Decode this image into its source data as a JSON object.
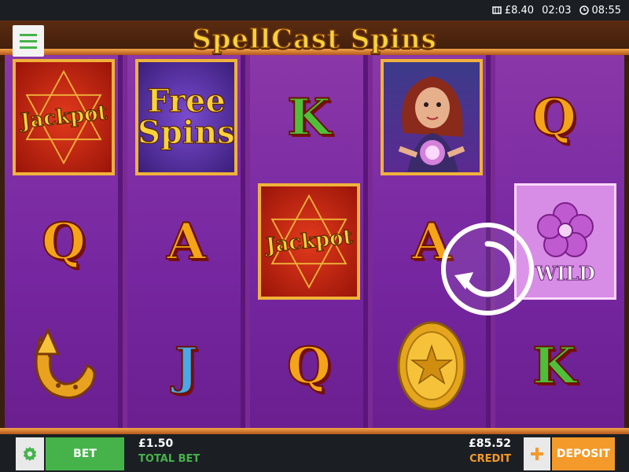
{
  "status_bar": {
    "balance": "£8.40",
    "elapsed": "02:03",
    "clock": "08:55"
  },
  "game": {
    "title": "SpellCast Spins"
  },
  "reels": [
    {
      "id": "reel-1",
      "symbols": [
        {
          "type": "jackpot",
          "label": "Jackpot"
        },
        {
          "type": "letter",
          "label": "Q"
        },
        {
          "type": "horseshoe",
          "label": ""
        }
      ]
    },
    {
      "id": "reel-2",
      "symbols": [
        {
          "type": "free-spins",
          "label_line1": "Free",
          "label_line2": "Spins"
        },
        {
          "type": "letter",
          "label": "A"
        },
        {
          "type": "letter",
          "label": "J"
        }
      ]
    },
    {
      "id": "reel-3",
      "symbols": [
        {
          "type": "letter",
          "label": "K"
        },
        {
          "type": "jackpot",
          "label": "Jackpot"
        },
        {
          "type": "letter",
          "label": "Q"
        }
      ]
    },
    {
      "id": "reel-4",
      "symbols": [
        {
          "type": "witch",
          "label": ""
        },
        {
          "type": "letter",
          "label": "A"
        },
        {
          "type": "gold-coin",
          "label": ""
        }
      ]
    },
    {
      "id": "reel-5",
      "symbols": [
        {
          "type": "letter",
          "label": "Q"
        },
        {
          "type": "wild",
          "label": "WILD"
        },
        {
          "type": "letter",
          "label": "K"
        }
      ]
    }
  ],
  "bottom_bar": {
    "bet_label": "BET",
    "total_bet_value": "£1.50",
    "total_bet_label": "TOTAL BET",
    "credit_value": "£85.52",
    "credit_label": "CREDIT",
    "deposit_label": "DEPOSIT"
  },
  "colors": {
    "green": "#46b34a",
    "orange": "#f39a2a",
    "purple": "#7b2a95",
    "gold": "#f7d23c"
  },
  "icons": [
    "hamburger-menu-icon",
    "clock-icon",
    "spin-icon",
    "gear-icon",
    "plus-icon"
  ]
}
